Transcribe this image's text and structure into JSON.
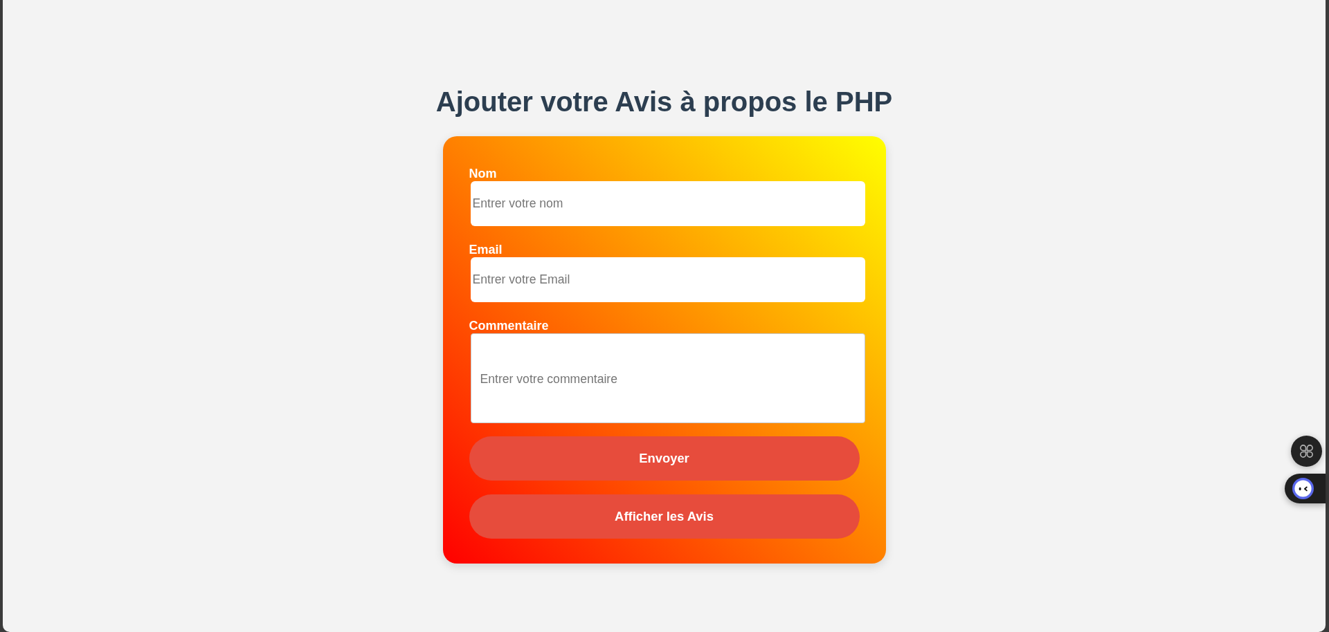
{
  "page_title": "Ajouter votre Avis à propos le PHP",
  "form": {
    "fields": [
      {
        "kind": "input",
        "label": "Nom",
        "placeholder": "Entrer votre nom"
      },
      {
        "kind": "input",
        "label": "Email",
        "placeholder": "Entrer votre Email"
      },
      {
        "kind": "textarea",
        "label": "Commentaire",
        "placeholder": "Entrer votre commentaire"
      }
    ],
    "buttons": [
      {
        "label": "Envoyer"
      },
      {
        "label": "Afficher les Avis"
      }
    ]
  }
}
